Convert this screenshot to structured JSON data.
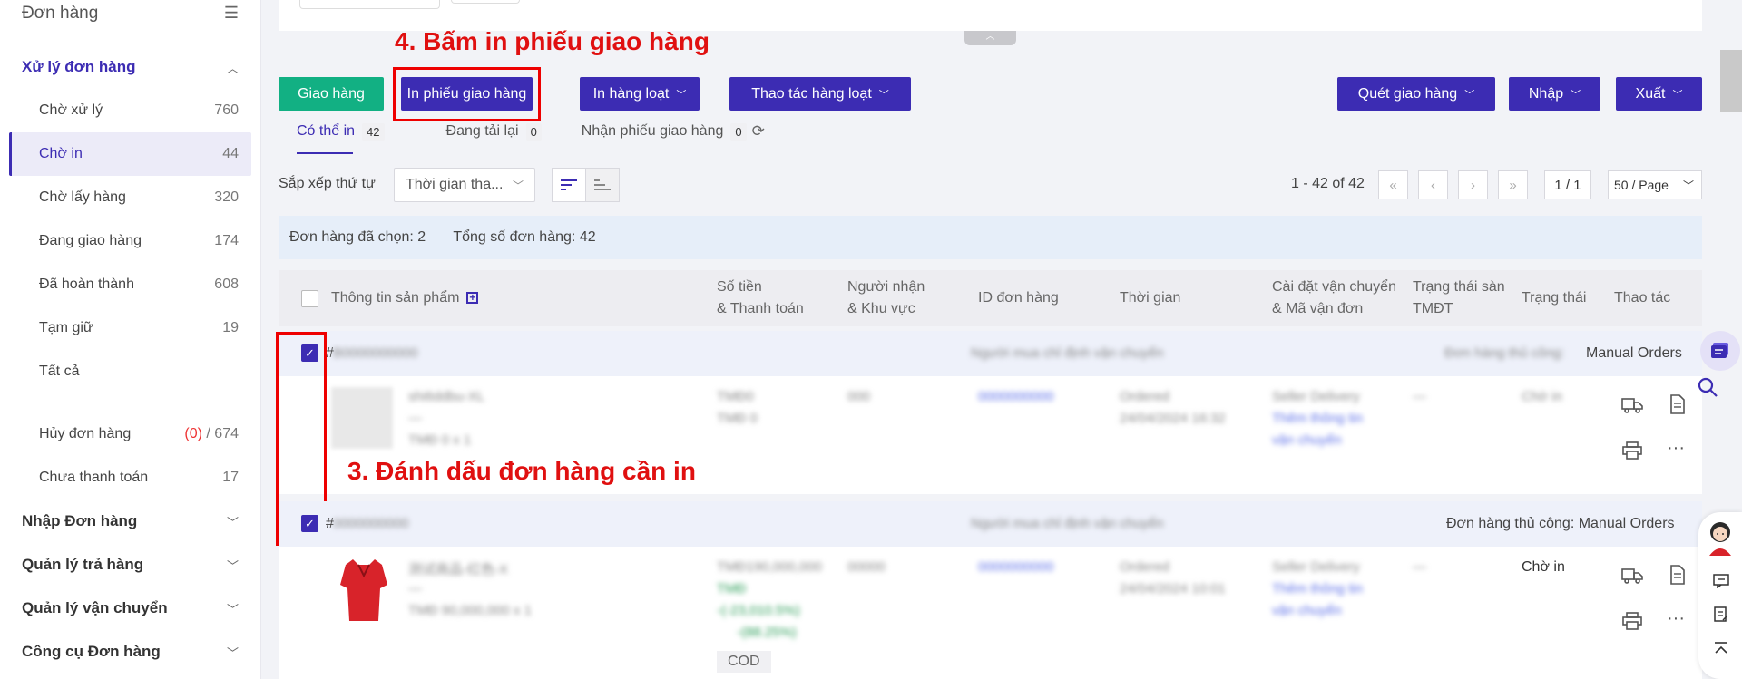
{
  "sidebar": {
    "title": "Đơn hàng",
    "groups": {
      "processing": "Xử lý đơn hàng",
      "import": "Nhập Đơn hàng",
      "returns": "Quản lý trả hàng",
      "shipping": "Quản lý vận chuyển",
      "tools": "Công cụ Đơn hàng"
    },
    "items": [
      {
        "label": "Chờ xử lý",
        "count": "760"
      },
      {
        "label": "Chờ in",
        "count": "44"
      },
      {
        "label": "Chờ lấy hàng",
        "count": "320"
      },
      {
        "label": "Đang giao hàng",
        "count": "174"
      },
      {
        "label": "Đã hoàn thành",
        "count": "608"
      },
      {
        "label": "Tạm giữ",
        "count": "19"
      },
      {
        "label": "Tất cả",
        "count": ""
      }
    ],
    "cancel": {
      "label": "Hủy đơn hàng",
      "count_red": "(0)",
      "count_rest": " / 674"
    },
    "unpaid": {
      "label": "Chưa thanh toán",
      "count": "17"
    }
  },
  "toolbar": {
    "ship": "Giao hàng",
    "print_slip": "In phiếu giao hàng",
    "bulk_print": "In hàng loạt",
    "bulk_action": "Thao tác hàng loạt",
    "scan_ship": "Quét giao hàng",
    "import": "Nhập",
    "export": "Xuất"
  },
  "annotations": {
    "step4": "4. Bấm in phiếu giao hàng",
    "step3": "3. Đánh dấu đơn hàng cần in"
  },
  "tabs": [
    {
      "label": "Có thể in",
      "count": "42"
    },
    {
      "label": "Đang tải lại",
      "count": "0"
    },
    {
      "label": "Nhận phiếu giao hàng",
      "count": "0"
    }
  ],
  "sort": {
    "label": "Sắp xếp thứ tự",
    "value": "Thời gian tha..."
  },
  "pager": {
    "range": "1 - 42 of 42",
    "page": "1 / 1",
    "page_size": "50 / Page"
  },
  "info": {
    "selected": "Đơn hàng đã chọn: 2",
    "total": "Tổng số đơn hàng: 42"
  },
  "table": {
    "headers": {
      "product": "Thông tin sản phẩm",
      "amount_1": "Số tiền",
      "amount_2": "& Thanh toán",
      "recipient_1": "Người nhận",
      "recipient_2": "& Khu vực",
      "order_id": "ID đơn hàng",
      "time": "Thời gian",
      "shipping_1": "Cài đặt vận chuyển",
      "shipping_2": "& Mã vận đơn",
      "ecom_status_1": "Trạng thái sàn",
      "ecom_status_2": "TMĐT",
      "status": "Trạng thái",
      "actions": "Thao tác"
    },
    "orders": [
      {
        "head_right": "Manual Orders",
        "status": ""
      },
      {
        "head_right": "Đơn hàng thủ công: Manual Orders",
        "status": "Chờ in",
        "payment_tag": "COD"
      }
    ]
  },
  "colors": {
    "primary": "#3c2cb3",
    "success": "#12b083",
    "annotation": "#e01010"
  }
}
